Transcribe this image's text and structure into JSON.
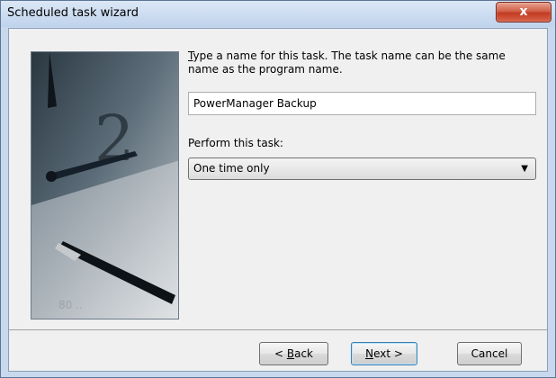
{
  "window": {
    "title": "Scheduled task wizard",
    "close_glyph": "x"
  },
  "content": {
    "prompt_accesskey": "T",
    "prompt_rest": "ype a name for this task.  The task name can be the same name as the program name.",
    "task_name_value": "PowerManager Backup",
    "perform_label": "Perform this task:",
    "perform_selected": "One time only"
  },
  "buttons": {
    "back_prefix": "< ",
    "back_accesskey": "B",
    "back_rest": "ack",
    "next_accesskey": "N",
    "next_rest": "ext >",
    "cancel": "Cancel"
  },
  "icons": {
    "close": "close-icon",
    "dropdown": "chevron-down-icon"
  },
  "colors": {
    "frame": "#c8d9ee",
    "close_button": "#c23b22",
    "default_button_border": "#3c7fb1"
  }
}
